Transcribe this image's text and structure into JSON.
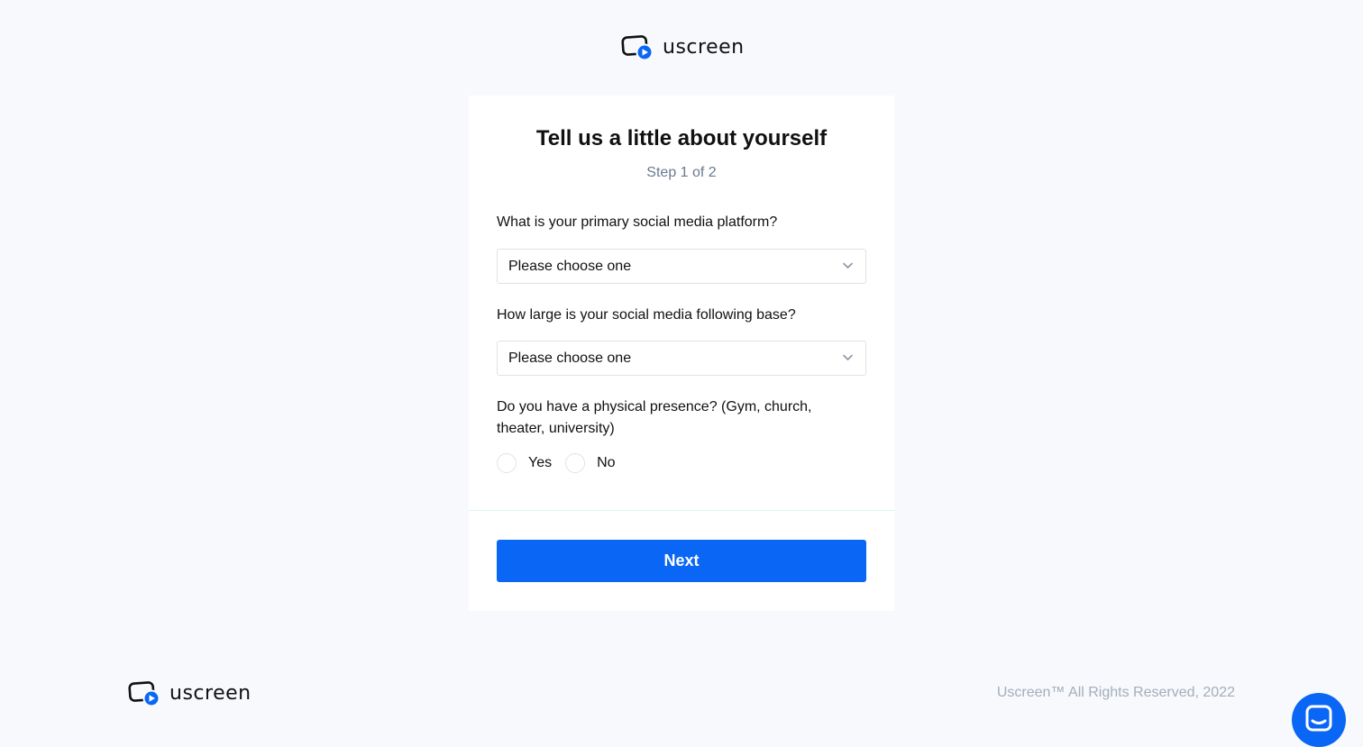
{
  "brand": {
    "name": "uscreen",
    "accent_color": "#0a66f5"
  },
  "form": {
    "title": "Tell us a little about yourself",
    "step": "Step 1 of 2",
    "questions": [
      {
        "label": "What is your primary social media platform?",
        "value": "Please choose one"
      },
      {
        "label": "How large is your social media following base?",
        "value": "Please choose one"
      }
    ],
    "presence": {
      "label": "Do you have a physical presence? (Gym, church, theater, university)",
      "options": [
        "Yes",
        "No"
      ]
    },
    "next_label": "Next"
  },
  "footer": {
    "copyright": "Uscreen™ All Rights Reserved, 2022"
  },
  "icons": {
    "logo": "screen-play-logo-icon",
    "dropdown": "chevron-down-icon",
    "chat": "chat-bubble-icon"
  }
}
